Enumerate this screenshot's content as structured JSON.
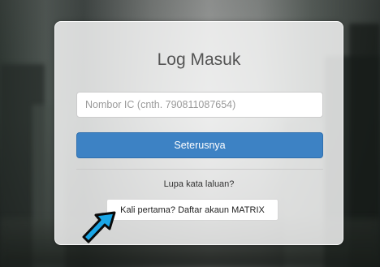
{
  "login": {
    "title": "Log Masuk",
    "ic_placeholder": "Nombor IC (cnth. 790811087654)",
    "ic_value": "",
    "next_label": "Seterusnya",
    "forgot_label": "Lupa kata laluan?",
    "register_label": "Kali pertama? Daftar akaun MATRIX"
  },
  "annotation": {
    "arrow_icon": "arrow-pointer-icon",
    "arrow_color": "#1aa6e6"
  },
  "colors": {
    "primary_button": "#3d82c4"
  }
}
